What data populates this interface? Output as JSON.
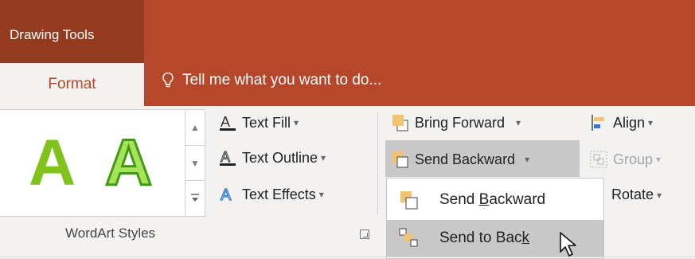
{
  "header": {
    "contextual_tab_group": "Drawing Tools",
    "active_tab": "Format",
    "tell_me": "Tell me what you want to do..."
  },
  "wordart": {
    "samples": [
      "A",
      "A"
    ],
    "group_label": "WordArt Styles",
    "text_fill": "Text Fill",
    "text_outline": "Text Outline",
    "text_effects": "Text Effects"
  },
  "arrange": {
    "bring_forward": "Bring Forward",
    "send_backward": "Send Backward",
    "align": "Align",
    "group": "Group",
    "rotate": "Rotate"
  },
  "send_menu": {
    "item1": {
      "pre": "Send ",
      "underline": "B",
      "post": "ackward"
    },
    "item2": {
      "pre": "Send to Bac",
      "underline": "k",
      "post": ""
    }
  },
  "colors": {
    "accent": "#b7472a",
    "contextual": "#933a1f",
    "ribbon": "#f3f2f1"
  }
}
